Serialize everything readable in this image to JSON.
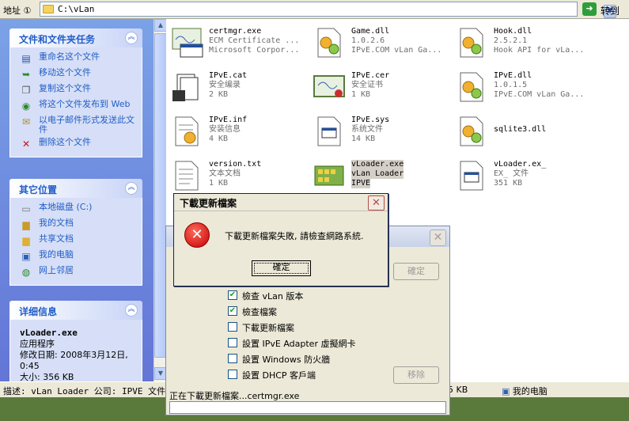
{
  "address": {
    "label": "地址 ①",
    "path": "C:\\vLan",
    "go_label": "转到"
  },
  "tasks": {
    "title": "文件和文件夹任务",
    "items": [
      {
        "label": "重命名这个文件",
        "icon": "rename-icon"
      },
      {
        "label": "移动这个文件",
        "icon": "move-icon"
      },
      {
        "label": "复制这个文件",
        "icon": "copy-icon"
      },
      {
        "label": "将这个文件发布到 Web",
        "icon": "publish-web-icon"
      },
      {
        "label": "以电子邮件形式发送此文件",
        "icon": "email-icon"
      },
      {
        "label": "删除这个文件",
        "icon": "delete-icon"
      }
    ]
  },
  "places": {
    "title": "其它位置",
    "items": [
      {
        "label": "本地磁盘 (C:)",
        "icon": "drive-icon"
      },
      {
        "label": "我的文档",
        "icon": "documents-icon"
      },
      {
        "label": "共享文档",
        "icon": "shared-folder-icon"
      },
      {
        "label": "我的电脑",
        "icon": "computer-icon"
      },
      {
        "label": "网上邻居",
        "icon": "network-icon"
      }
    ]
  },
  "details": {
    "title": "详细信息",
    "name": "vLoader.exe",
    "type": "应用程序",
    "modified": "修改日期: 2008年3月12日, 0:45",
    "size_partial": "大小: 356 KB"
  },
  "files": [
    {
      "name": "certmgr.exe",
      "line2": "ECM Certificate ...",
      "line3": "Microsoft Corpor...",
      "icon": "certificate-app-icon"
    },
    {
      "name": "Game.dll",
      "line2": "1.0.2.6",
      "line3": "IPvE.COM vLan Ga...",
      "icon": "dll-gear-icon"
    },
    {
      "name": "Hook.dll",
      "line2": "2.5.2.1",
      "line3": "Hook API for vLa...",
      "icon": "dll-gear-icon"
    },
    {
      "name": "IPvE.cat",
      "line2": "安全编录",
      "line3": "2 KB",
      "icon": "catalog-icon"
    },
    {
      "name": "IPvE.cer",
      "line2": "安全证书",
      "line3": "1 KB",
      "icon": "certificate-icon"
    },
    {
      "name": "IPvE.dll",
      "line2": "1.0.1.5",
      "line3": "IPvE.COM vLan Ga...",
      "icon": "dll-gear-icon"
    },
    {
      "name": "IPvE.inf",
      "line2": "安装信息",
      "line3": "4 KB",
      "icon": "setup-info-icon"
    },
    {
      "name": "IPvE.sys",
      "line2": "系统文件",
      "line3": "14 KB",
      "icon": "system-file-icon"
    },
    {
      "name": "sqlite3.dll",
      "line2": "",
      "line3": "",
      "icon": "dll-gear-icon"
    },
    {
      "name": "version.txt",
      "line2": "文本文档",
      "line3": "1 KB",
      "icon": "text-file-icon"
    },
    {
      "name": "vLoader.exe",
      "line2": "vLan Loader",
      "line3": "IPVE",
      "icon": "app-icon"
    },
    {
      "name": "vLoader.ex_",
      "line2": "EX_ 文件",
      "line3": "351 KB",
      "icon": "generic-file-icon"
    }
  ],
  "status": {
    "text": "描述: vLan Loader 公司: IPVE 文件版",
    "size": "5 KB",
    "computer": "我的电脑"
  },
  "updater": {
    "ok_label": "確定",
    "options": [
      {
        "label": "檢查 vLan 版本",
        "checked": true
      },
      {
        "label": "檢查檔案",
        "checked": true
      },
      {
        "label": "下載更新檔案",
        "checked": false
      },
      {
        "label": "設置 IPvE Adapter 虛擬網卡",
        "checked": false
      },
      {
        "label": "設置 Windows 防火牆",
        "checked": false
      },
      {
        "label": "設置 DHCP 客戶端",
        "checked": false
      }
    ],
    "remove_label": "移除",
    "status": "正在下載更新檔案...certmgr.exe"
  },
  "error_dialog": {
    "title": "下載更新檔案",
    "message": "下載更新檔案失敗, 請檢查網路系統.",
    "ok_label": "確定"
  }
}
